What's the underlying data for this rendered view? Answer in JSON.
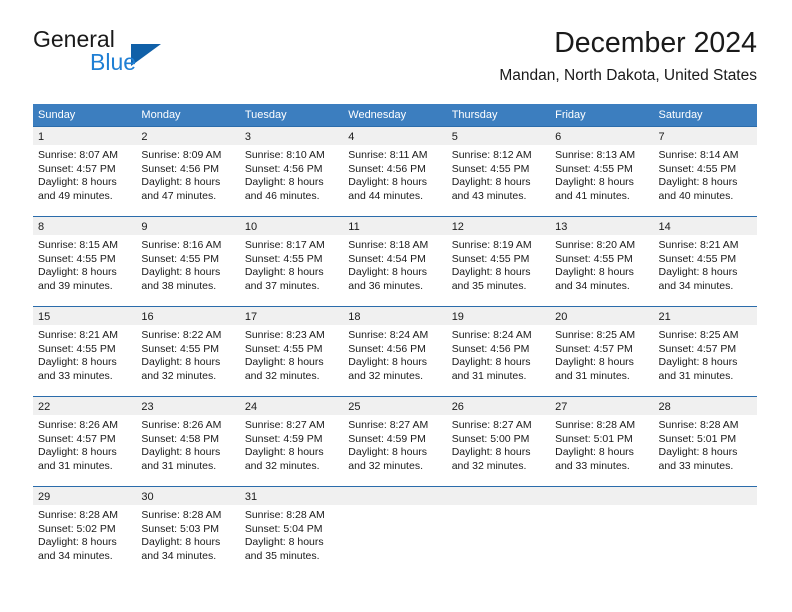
{
  "brand": {
    "name_part1": "General",
    "name_part2": "Blue",
    "logo_icon": "triangle-logo-icon",
    "accent_color": "#1060a8",
    "blue_text_color": "#1f7fd4"
  },
  "header": {
    "title": "December 2024",
    "location": "Mandan, North Dakota, United States"
  },
  "calendar": {
    "header_bg_color": "#3c7ebf",
    "row_divider_color": "#2b6cab",
    "day_band_color": "#f0f0f0",
    "weekdays": [
      "Sunday",
      "Monday",
      "Tuesday",
      "Wednesday",
      "Thursday",
      "Friday",
      "Saturday"
    ],
    "weeks": [
      [
        {
          "day": "1",
          "sunrise": "Sunrise: 8:07 AM",
          "sunset": "Sunset: 4:57 PM",
          "daylight_line1": "Daylight: 8 hours",
          "daylight_line2": "and 49 minutes."
        },
        {
          "day": "2",
          "sunrise": "Sunrise: 8:09 AM",
          "sunset": "Sunset: 4:56 PM",
          "daylight_line1": "Daylight: 8 hours",
          "daylight_line2": "and 47 minutes."
        },
        {
          "day": "3",
          "sunrise": "Sunrise: 8:10 AM",
          "sunset": "Sunset: 4:56 PM",
          "daylight_line1": "Daylight: 8 hours",
          "daylight_line2": "and 46 minutes."
        },
        {
          "day": "4",
          "sunrise": "Sunrise: 8:11 AM",
          "sunset": "Sunset: 4:56 PM",
          "daylight_line1": "Daylight: 8 hours",
          "daylight_line2": "and 44 minutes."
        },
        {
          "day": "5",
          "sunrise": "Sunrise: 8:12 AM",
          "sunset": "Sunset: 4:55 PM",
          "daylight_line1": "Daylight: 8 hours",
          "daylight_line2": "and 43 minutes."
        },
        {
          "day": "6",
          "sunrise": "Sunrise: 8:13 AM",
          "sunset": "Sunset: 4:55 PM",
          "daylight_line1": "Daylight: 8 hours",
          "daylight_line2": "and 41 minutes."
        },
        {
          "day": "7",
          "sunrise": "Sunrise: 8:14 AM",
          "sunset": "Sunset: 4:55 PM",
          "daylight_line1": "Daylight: 8 hours",
          "daylight_line2": "and 40 minutes."
        }
      ],
      [
        {
          "day": "8",
          "sunrise": "Sunrise: 8:15 AM",
          "sunset": "Sunset: 4:55 PM",
          "daylight_line1": "Daylight: 8 hours",
          "daylight_line2": "and 39 minutes."
        },
        {
          "day": "9",
          "sunrise": "Sunrise: 8:16 AM",
          "sunset": "Sunset: 4:55 PM",
          "daylight_line1": "Daylight: 8 hours",
          "daylight_line2": "and 38 minutes."
        },
        {
          "day": "10",
          "sunrise": "Sunrise: 8:17 AM",
          "sunset": "Sunset: 4:55 PM",
          "daylight_line1": "Daylight: 8 hours",
          "daylight_line2": "and 37 minutes."
        },
        {
          "day": "11",
          "sunrise": "Sunrise: 8:18 AM",
          "sunset": "Sunset: 4:54 PM",
          "daylight_line1": "Daylight: 8 hours",
          "daylight_line2": "and 36 minutes."
        },
        {
          "day": "12",
          "sunrise": "Sunrise: 8:19 AM",
          "sunset": "Sunset: 4:55 PM",
          "daylight_line1": "Daylight: 8 hours",
          "daylight_line2": "and 35 minutes."
        },
        {
          "day": "13",
          "sunrise": "Sunrise: 8:20 AM",
          "sunset": "Sunset: 4:55 PM",
          "daylight_line1": "Daylight: 8 hours",
          "daylight_line2": "and 34 minutes."
        },
        {
          "day": "14",
          "sunrise": "Sunrise: 8:21 AM",
          "sunset": "Sunset: 4:55 PM",
          "daylight_line1": "Daylight: 8 hours",
          "daylight_line2": "and 34 minutes."
        }
      ],
      [
        {
          "day": "15",
          "sunrise": "Sunrise: 8:21 AM",
          "sunset": "Sunset: 4:55 PM",
          "daylight_line1": "Daylight: 8 hours",
          "daylight_line2": "and 33 minutes."
        },
        {
          "day": "16",
          "sunrise": "Sunrise: 8:22 AM",
          "sunset": "Sunset: 4:55 PM",
          "daylight_line1": "Daylight: 8 hours",
          "daylight_line2": "and 32 minutes."
        },
        {
          "day": "17",
          "sunrise": "Sunrise: 8:23 AM",
          "sunset": "Sunset: 4:55 PM",
          "daylight_line1": "Daylight: 8 hours",
          "daylight_line2": "and 32 minutes."
        },
        {
          "day": "18",
          "sunrise": "Sunrise: 8:24 AM",
          "sunset": "Sunset: 4:56 PM",
          "daylight_line1": "Daylight: 8 hours",
          "daylight_line2": "and 32 minutes."
        },
        {
          "day": "19",
          "sunrise": "Sunrise: 8:24 AM",
          "sunset": "Sunset: 4:56 PM",
          "daylight_line1": "Daylight: 8 hours",
          "daylight_line2": "and 31 minutes."
        },
        {
          "day": "20",
          "sunrise": "Sunrise: 8:25 AM",
          "sunset": "Sunset: 4:57 PM",
          "daylight_line1": "Daylight: 8 hours",
          "daylight_line2": "and 31 minutes."
        },
        {
          "day": "21",
          "sunrise": "Sunrise: 8:25 AM",
          "sunset": "Sunset: 4:57 PM",
          "daylight_line1": "Daylight: 8 hours",
          "daylight_line2": "and 31 minutes."
        }
      ],
      [
        {
          "day": "22",
          "sunrise": "Sunrise: 8:26 AM",
          "sunset": "Sunset: 4:57 PM",
          "daylight_line1": "Daylight: 8 hours",
          "daylight_line2": "and 31 minutes."
        },
        {
          "day": "23",
          "sunrise": "Sunrise: 8:26 AM",
          "sunset": "Sunset: 4:58 PM",
          "daylight_line1": "Daylight: 8 hours",
          "daylight_line2": "and 31 minutes."
        },
        {
          "day": "24",
          "sunrise": "Sunrise: 8:27 AM",
          "sunset": "Sunset: 4:59 PM",
          "daylight_line1": "Daylight: 8 hours",
          "daylight_line2": "and 32 minutes."
        },
        {
          "day": "25",
          "sunrise": "Sunrise: 8:27 AM",
          "sunset": "Sunset: 4:59 PM",
          "daylight_line1": "Daylight: 8 hours",
          "daylight_line2": "and 32 minutes."
        },
        {
          "day": "26",
          "sunrise": "Sunrise: 8:27 AM",
          "sunset": "Sunset: 5:00 PM",
          "daylight_line1": "Daylight: 8 hours",
          "daylight_line2": "and 32 minutes."
        },
        {
          "day": "27",
          "sunrise": "Sunrise: 8:28 AM",
          "sunset": "Sunset: 5:01 PM",
          "daylight_line1": "Daylight: 8 hours",
          "daylight_line2": "and 33 minutes."
        },
        {
          "day": "28",
          "sunrise": "Sunrise: 8:28 AM",
          "sunset": "Sunset: 5:01 PM",
          "daylight_line1": "Daylight: 8 hours",
          "daylight_line2": "and 33 minutes."
        }
      ],
      [
        {
          "day": "29",
          "sunrise": "Sunrise: 8:28 AM",
          "sunset": "Sunset: 5:02 PM",
          "daylight_line1": "Daylight: 8 hours",
          "daylight_line2": "and 34 minutes."
        },
        {
          "day": "30",
          "sunrise": "Sunrise: 8:28 AM",
          "sunset": "Sunset: 5:03 PM",
          "daylight_line1": "Daylight: 8 hours",
          "daylight_line2": "and 34 minutes."
        },
        {
          "day": "31",
          "sunrise": "Sunrise: 8:28 AM",
          "sunset": "Sunset: 5:04 PM",
          "daylight_line1": "Daylight: 8 hours",
          "daylight_line2": "and 35 minutes."
        },
        {
          "day": "",
          "sunrise": "",
          "sunset": "",
          "daylight_line1": "",
          "daylight_line2": ""
        },
        {
          "day": "",
          "sunrise": "",
          "sunset": "",
          "daylight_line1": "",
          "daylight_line2": ""
        },
        {
          "day": "",
          "sunrise": "",
          "sunset": "",
          "daylight_line1": "",
          "daylight_line2": ""
        },
        {
          "day": "",
          "sunrise": "",
          "sunset": "",
          "daylight_line1": "",
          "daylight_line2": ""
        }
      ]
    ]
  }
}
